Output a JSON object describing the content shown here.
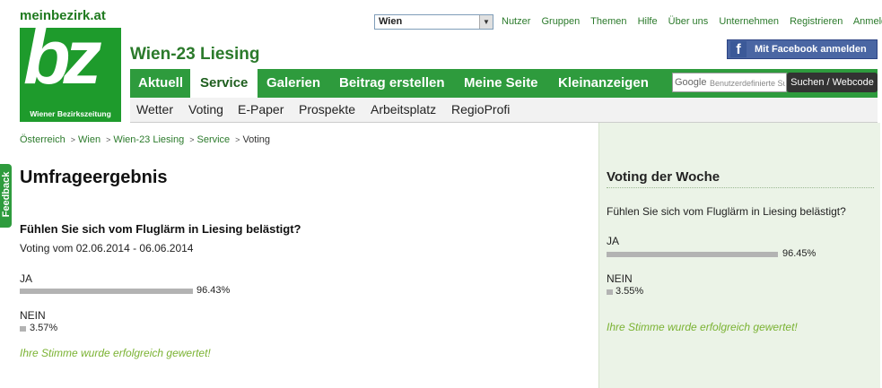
{
  "header": {
    "site_name": "meinbezirk.at",
    "logo_text": "bz",
    "logo_tagline": "Wiener Bezirkszeitung",
    "region_title": "Wien-23 Liesing",
    "region_select_value": "Wien",
    "top_links": [
      "Nutzer",
      "Gruppen",
      "Themen",
      "Hilfe",
      "Über uns",
      "Unternehmen",
      "Registrieren",
      "Anmelden"
    ],
    "facebook_button": "Mit Facebook anmelden"
  },
  "main_nav": {
    "items": [
      "Aktuell",
      "Service",
      "Galerien",
      "Beitrag erstellen",
      "Meine Seite",
      "Kleinanzeigen"
    ],
    "active": "Service",
    "search_logo": "Google",
    "search_placeholder": "Benutzerdefinierte Suche",
    "search_button": "Suchen / Webcode"
  },
  "sub_nav": {
    "items": [
      "Wetter",
      "Voting",
      "E-Paper",
      "Prospekte",
      "Arbeitsplatz",
      "RegioProfi"
    ]
  },
  "breadcrumb": {
    "items": [
      "Österreich",
      "Wien",
      "Wien-23 Liesing",
      "Service"
    ],
    "current": "Voting"
  },
  "feedback_tab": "Feedback",
  "main": {
    "title": "Umfrageergebnis",
    "question": "Fühlen Sie sich vom Fluglärm in Liesing belästigt?",
    "period": "Voting vom 02.06.2014 - 06.06.2014",
    "options": [
      {
        "label": "JA",
        "percent_text": "96.43%",
        "percent": 96.43
      },
      {
        "label": "NEIN",
        "percent_text": "3.57%",
        "percent": 3.57
      }
    ],
    "success": "Ihre Stimme wurde erfolgreich gewertet!"
  },
  "sidebar": {
    "title": "Voting der Woche",
    "question": "Fühlen Sie sich vom Fluglärm in Liesing belästigt?",
    "options": [
      {
        "label": "JA",
        "percent_text": "96.45%",
        "percent": 96.45
      },
      {
        "label": "NEIN",
        "percent_text": "3.55%",
        "percent": 3.55
      }
    ],
    "success": "Ihre Stimme wurde erfolgreich gewertet!"
  },
  "colors": {
    "brand_green": "#2e9b3d",
    "success_green": "#7ab232",
    "facebook_blue": "#4a66a3"
  }
}
